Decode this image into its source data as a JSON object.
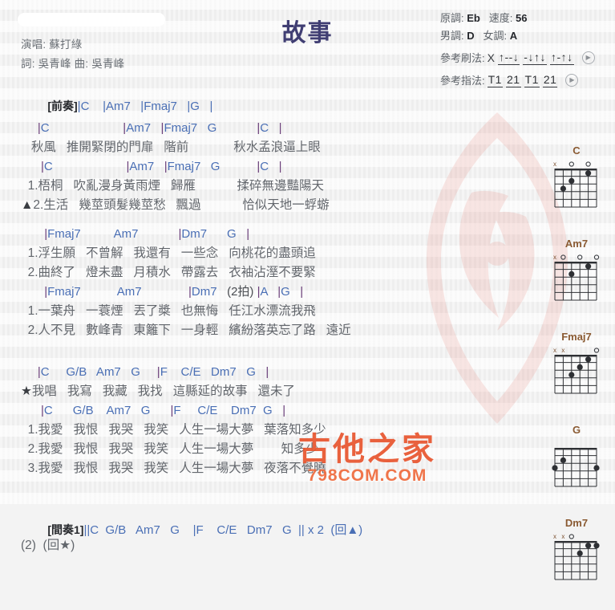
{
  "header": {
    "title": "故事",
    "singer_line": "演唱: 蘇打綠",
    "writer_line": "詞: 吳青峰  曲: 吳青峰",
    "redacted_bar": ""
  },
  "info": {
    "key_label": "原調:",
    "key_value": "Eb",
    "tempo_label": "速度:",
    "tempo_value": "56",
    "male_key_label": "男調:",
    "male_key_value": "D",
    "female_key_label": "女調:",
    "female_key_value": "A",
    "strum_label": "參考刷法:",
    "strum_x": "X",
    "strum_groups": [
      "↑--↓",
      "-↓↑↓",
      "↑-↑↓"
    ],
    "fingerstyle_label": "參考指法:",
    "fingerstyle_groups": [
      "T1",
      "21",
      "T1",
      "21"
    ],
    "play_icon": "play-icon"
  },
  "sheet": {
    "intro": {
      "tag": "[前奏]",
      "chords": "|C    |Am7   |Fmaj7   |G   |"
    },
    "verse1": {
      "rows": [
        {
          "type": "chord",
          "text": "     |C                      |Am7   |Fmaj7   G            |C   |"
        },
        {
          "type": "lyric",
          "text": "   秋風   推開緊閉的門扉   階前             秋水孟浪逼上眼"
        },
        {
          "type": "chord",
          "text": "      |C                      |Am7   |Fmaj7   G           |C   |"
        },
        {
          "type": "lyric",
          "text": "  1.梧桐   吹亂漫身黃雨煙   歸雁            揉碎無邊豔陽天"
        },
        {
          "type": "lyric",
          "text": "▲2.生活   幾莖頭髮幾莖愁   飄過            恰似天地一蜉蝣"
        }
      ]
    },
    "verse2": {
      "rows": [
        {
          "type": "chord",
          "text": "       |Fmaj7          Am7            |Dm7      G   |"
        },
        {
          "type": "lyric",
          "text": "  1.浮生願   不曾解   我還有   一些念   向桃花的盡頭追"
        },
        {
          "type": "lyric",
          "text": "  2.曲終了   燈未盡   月積水   帶露去   衣袖沾溼不要緊"
        },
        {
          "type": "chord",
          "text": "       |Fmaj7           Am7              |Dm7   (2拍) |A   |G   |"
        },
        {
          "type": "lyric",
          "text": "  1.一葉舟   一蓑煙   丟了槳   也無悔   任江水漂流我飛"
        },
        {
          "type": "lyric",
          "text": "  2.人不見   數峰青   東籬下   一身輕   繽紛落英忘了路   遠近"
        }
      ]
    },
    "chorus": {
      "rows": [
        {
          "type": "chord",
          "text": "     |C     G/B   Am7   G     |F    C/E   Dm7   G   |"
        },
        {
          "type": "lyric",
          "text": "★我唱   我寫   我藏   我找   這縣延的故事   還未了"
        },
        {
          "type": "chord",
          "text": "      |C      G/B    Am7   G      |F     C/E    Dm7  G   |"
        },
        {
          "type": "lyric",
          "text": "  1.我愛   我恨   我哭   我笑   人生一場大夢   葉落知多少"
        },
        {
          "type": "lyric",
          "text": "  2.我愛   我恨   我哭   我笑   人生一場大夢        知多少"
        },
        {
          "type": "lyric",
          "text": "  3.我愛   我恨   我哭   我笑   人生一場大夢   夜落不覺曉"
        }
      ]
    },
    "interlude": {
      "tag": "[間奏1]",
      "chords": "||C  G/B   Am7   G    |F    C/E   Dm7   G  || x 2  (回▲)"
    },
    "repeat": {
      "text": "(2)  (回★)"
    }
  },
  "chord_diagrams": [
    {
      "name": "C",
      "markers": [
        "x",
        "",
        "o",
        "",
        "o",
        ""
      ],
      "dots": [
        {
          "string": 5,
          "fret": 3
        },
        {
          "string": 4,
          "fret": 2
        },
        {
          "string": 2,
          "fret": 1
        }
      ],
      "frets": 5
    },
    {
      "name": "Am7",
      "markers": [
        "x",
        "o",
        "",
        "o",
        "",
        "o"
      ],
      "dots": [
        {
          "string": 4,
          "fret": 2
        },
        {
          "string": 2,
          "fret": 1
        }
      ],
      "frets": 5
    },
    {
      "name": "Fmaj7",
      "markers": [
        "x",
        "x",
        "",
        "",
        "",
        "o"
      ],
      "dots": [
        {
          "string": 4,
          "fret": 3
        },
        {
          "string": 3,
          "fret": 2
        },
        {
          "string": 2,
          "fret": 1
        }
      ],
      "frets": 5
    },
    {
      "name": "G",
      "markers": [
        "",
        "",
        "",
        "",
        "",
        ""
      ],
      "dots": [
        {
          "string": 6,
          "fret": 3
        },
        {
          "string": 5,
          "fret": 2
        },
        {
          "string": 1,
          "fret": 3
        }
      ],
      "frets": 5
    },
    {
      "name": "Dm7",
      "markers": [
        "x",
        "x",
        "o",
        "",
        "",
        ""
      ],
      "dots": [
        {
          "string": 3,
          "fret": 2
        },
        {
          "string": 2,
          "fret": 1
        },
        {
          "string": 1,
          "fret": 1
        }
      ],
      "frets": 5
    }
  ],
  "watermark": {
    "cn": "古他之家",
    "en": "798COM.COM"
  },
  "colors": {
    "title": "#403e73",
    "chord": "#4a6fb5",
    "bar": "#6b3f7a",
    "lyric": "#62666c",
    "chord_name": "#8a5a32",
    "watermark": "#e8552e",
    "background": "#f4f4f4"
  }
}
